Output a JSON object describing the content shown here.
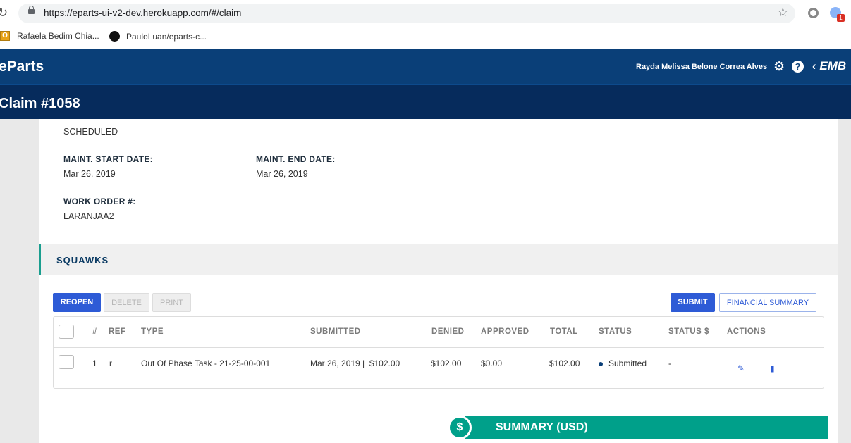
{
  "browser": {
    "url": "https://eparts-ui-v2-dev.herokuapp.com/#/claim",
    "bookmarks": [
      "Rafaela Bedim Chia...",
      "PauloLuan/eparts-c..."
    ],
    "ext_badge": "1"
  },
  "header": {
    "logo": "eParts",
    "user_name": "Rayda Melissa Belone Correa Alves",
    "brand": "EMB"
  },
  "claim": {
    "title": "Claim #1058"
  },
  "details": {
    "visit_type_value": "SCHEDULED",
    "maint_start_label": "MAINT. START DATE:",
    "maint_start_value": "Mar 26, 2019",
    "maint_end_label": "MAINT. END DATE:",
    "maint_end_value": "Mar 26, 2019",
    "work_order_label": "WORK ORDER #:",
    "work_order_value": "LARANJAA2"
  },
  "squawks": {
    "title": "SQUAWKS",
    "buttons": {
      "reopen": "REOPEN",
      "delete": "DELETE",
      "print": "PRINT",
      "submit": "SUBMIT",
      "financial_summary": "FINANCIAL SUMMARY"
    },
    "columns": {
      "num": "#",
      "ref": "REF",
      "type": "TYPE",
      "submitted": "SUBMITTED",
      "denied": "DENIED",
      "approved": "APPROVED",
      "total": "TOTAL",
      "status": "STATUS",
      "status_money": "STATUS $",
      "actions": "ACTIONS"
    },
    "rows": [
      {
        "num": "1",
        "ref": "r",
        "type": "Out Of Phase Task - 21-25-00-001",
        "submitted": "Mar 26, 2019 |  $102.00",
        "denied": "$102.00",
        "approved": "$0.00",
        "total": "$102.00",
        "status": "Submitted",
        "status_money": "-"
      }
    ]
  },
  "summary": {
    "title": "SUMMARY (USD)",
    "symbol": "$"
  },
  "colors": {
    "header": "#0a3f78",
    "subheader": "#062b5c",
    "accent": "#2e5bd6",
    "teal": "#00a08a"
  },
  "icons": [
    "reload-icon",
    "lock-icon",
    "star-icon",
    "gear-icon",
    "help-icon",
    "edit-icon",
    "book-icon",
    "dollar-icon"
  ]
}
